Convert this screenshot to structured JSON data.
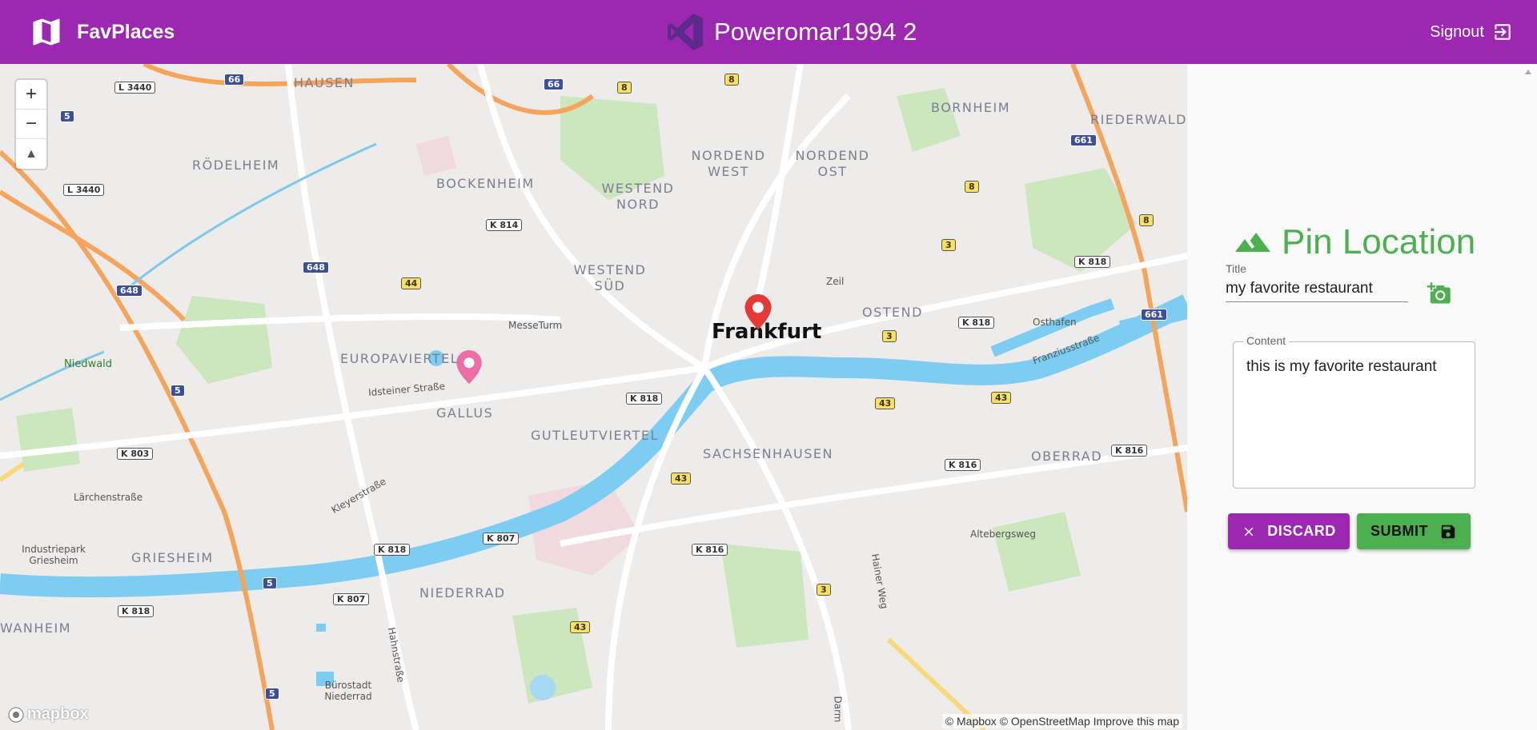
{
  "app": {
    "title": "FavPlaces"
  },
  "user": {
    "name": "Poweromar1994 2"
  },
  "header": {
    "signout_label": "Signout"
  },
  "map": {
    "city_label": "Frankfurt",
    "districts": [
      "HAUSEN",
      "RÖDELHEIM",
      "BOCKENHEIM",
      "WESTEND NORD",
      "NORDEND WEST",
      "NORDEND OST",
      "BORNHEIM",
      "RIEDERWALD",
      "WESTEND SÜD",
      "OSTEND",
      "EUROPAVIERTEL",
      "GALLUS",
      "GUTLEUTVIERTEL",
      "SACHSENHAUSEN",
      "OBERRAD",
      "GRIESHEIM",
      "NIEDERRAD",
      "WANHEIM"
    ],
    "places": [
      "Niedwald",
      "MesseTurm",
      "Idsteiner Straße",
      "Kleyerstraße",
      "Lärchenstraße",
      "Industriepark Griesheim",
      "Hahnstraße",
      "Bürostadt Niederrad",
      "Zeil",
      "Osthafen",
      "Franziusstraße",
      "Altebergsweg",
      "Hainer Weg",
      "Darm"
    ],
    "road_shields": [
      "L 3440",
      "66",
      "5",
      "L 3440",
      "K 814",
      "648",
      "44",
      "648",
      "K 803",
      "5",
      "K 818",
      "K 807",
      "K 818",
      "K 807",
      "5",
      "K 818",
      "8",
      "66",
      "8",
      "8",
      "3",
      "K 818",
      "661",
      "8",
      "K 818",
      "3",
      "43",
      "43",
      "K 816",
      "K 816",
      "43",
      "K 816",
      "3",
      "43",
      "5",
      "661"
    ],
    "attribution": "© Mapbox © OpenStreetMap Improve this map",
    "logo": "mapbox",
    "zoom_in": "+",
    "zoom_out": "−",
    "compass": "▲"
  },
  "form": {
    "heading": "Pin Location",
    "title_label": "Title",
    "title_value": "my favorite restaurant",
    "content_label": "Content",
    "content_value": "this is my favorite restaurant",
    "discard_label": "DISCARD",
    "submit_label": "SUBMIT"
  },
  "colors": {
    "primary": "#9c27b0",
    "accent": "#4caf50",
    "river": "#7ccdf1"
  },
  "icons": [
    "map-icon",
    "visual-studio-logo-icon",
    "signout-icon",
    "terrain-icon",
    "add-photo-icon",
    "close-icon",
    "save-icon",
    "map-pin-icon"
  ]
}
